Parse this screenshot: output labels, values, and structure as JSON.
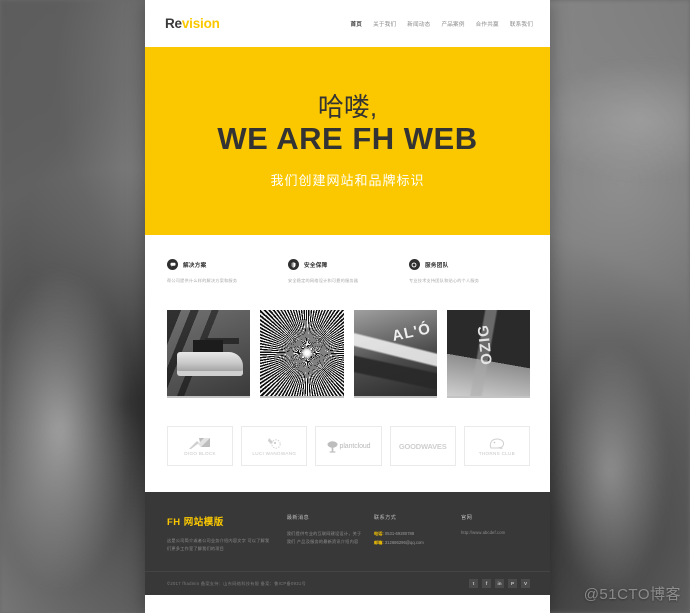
{
  "header": {
    "logo_re": "Re",
    "logo_vision": "vision",
    "nav": [
      {
        "label": "首页",
        "active": true
      },
      {
        "label": "关于我们",
        "active": false
      },
      {
        "label": "新闻动态",
        "active": false
      },
      {
        "label": "产品案例",
        "active": false
      },
      {
        "label": "合作共赢",
        "active": false
      },
      {
        "label": "联系我们",
        "active": false
      }
    ]
  },
  "hero": {
    "greeting": "哈喽,",
    "title": "WE ARE FH WEB",
    "subtitle": "我们创建网站和品牌标识",
    "background_color": "#fbc800"
  },
  "features": [
    {
      "icon": "chat-icon",
      "title": "解决方案",
      "desc": "帮公司提供什么样的解决方案和服务"
    },
    {
      "icon": "shield-icon",
      "title": "安全保障",
      "desc": "安全稳定的网络设计和可靠的服务器"
    },
    {
      "icon": "play-icon",
      "title": "服务团队",
      "desc": "专业技术支持团队和贴心的个人服务"
    }
  ],
  "gallery": [
    {
      "caption": "ship-photo"
    },
    {
      "caption": "fiber-optic-photo"
    },
    {
      "caption": "street-sign-photo"
    },
    {
      "caption": "guitar-headstock-photo"
    }
  ],
  "clients": [
    {
      "mark": "diagonal-arrow-icon",
      "name": "DIGO BLOCK"
    },
    {
      "mark": "bird-icon",
      "name": "LUCI WANGWANG"
    },
    {
      "mark": "tree-icon",
      "name": "plantcloud",
      "style": "inline"
    },
    {
      "mark": "wave-icon",
      "name": "GOODWAVES",
      "style": "bold"
    },
    {
      "mark": "elephant-icon",
      "name": "THORNS CLUB"
    }
  ],
  "footer": {
    "logo": "FH 网站模版",
    "brand_desc": "这是公司简介或者公司业务介绍内容文字\n可以了解我们更多工作室了解我们的项目",
    "col2": {
      "title": "最新消息",
      "text": "我们提供专业的互联网建设设计，关于我们\n产品及服务的最新资讯介绍内容"
    },
    "col3": {
      "title": "联系方式",
      "phone_label": "电话:",
      "phone": "0531-69280788",
      "email_label": "邮箱:",
      "email": "312686296@qq.com"
    },
    "col4": {
      "title": "官网",
      "url": "http://www.abcdef.com"
    },
    "copyright": "©2017 fhadmin  备案支持：山东网络科技有限  备案：鲁ICP备0931号",
    "socials": [
      {
        "name": "twitter-icon",
        "glyph": "t"
      },
      {
        "name": "facebook-icon",
        "glyph": "f"
      },
      {
        "name": "linkedin-icon",
        "glyph": "in"
      },
      {
        "name": "pinterest-icon",
        "glyph": "P"
      },
      {
        "name": "vimeo-icon",
        "glyph": "V"
      }
    ]
  },
  "watermark": "@51CTO博客"
}
